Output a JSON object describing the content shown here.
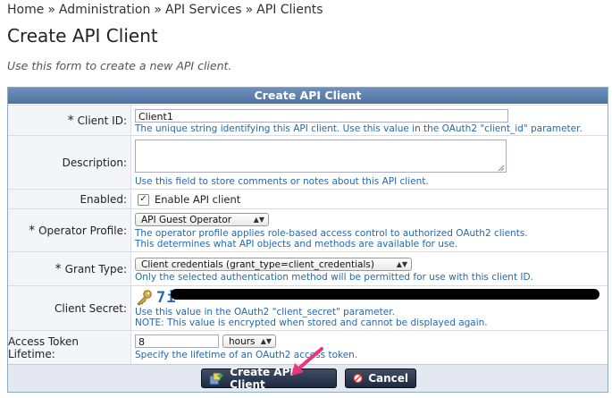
{
  "breadcrumb": {
    "items": [
      "Home",
      "Administration",
      "API Services",
      "API Clients"
    ],
    "separator": "»"
  },
  "page": {
    "title": "Create API Client",
    "description": "Use this form to create a new API client."
  },
  "form": {
    "header": "Create API Client",
    "client_id": {
      "label": "Client ID:",
      "value": "Client1",
      "help": "The unique string identifying this API client. Use this value in the OAuth2 \"client_id\" parameter."
    },
    "description": {
      "label": "Description:",
      "value": "",
      "help": "Use this field to store comments or notes about this API client."
    },
    "enabled": {
      "label": "Enabled:",
      "checkbox_label": "Enable API client",
      "checked": true
    },
    "operator_profile": {
      "label": "Operator Profile:",
      "selected": "API Guest Operator",
      "help_line1": "The operator profile applies role-based access control to authorized OAuth2 clients.",
      "help_line2": "This determines what API objects and methods are available for use."
    },
    "grant_type": {
      "label": "Grant Type:",
      "selected": "Client credentials (grant_type=client_credentials)",
      "help": "Only the selected authentication method will be permitted for use with this client ID."
    },
    "client_secret": {
      "label": "Client Secret:",
      "value_visible": "7i",
      "help_line1": "Use this value in the OAuth2 \"client_secret\" parameter.",
      "help_line2": "NOTE: This value is encrypted when stored and cannot be displayed again."
    },
    "token_lifetime": {
      "label": "Access Token Lifetime:",
      "value": "8",
      "unit_selected": "hours",
      "help": "Specify the lifetime of an OAuth2 access token."
    }
  },
  "buttons": {
    "create_label": "Create API Client",
    "cancel_label": "Cancel"
  },
  "colors": {
    "help_text": "#2469b0",
    "header_bg": "#5a7dab",
    "pointer_arrow": "#e8367d"
  }
}
